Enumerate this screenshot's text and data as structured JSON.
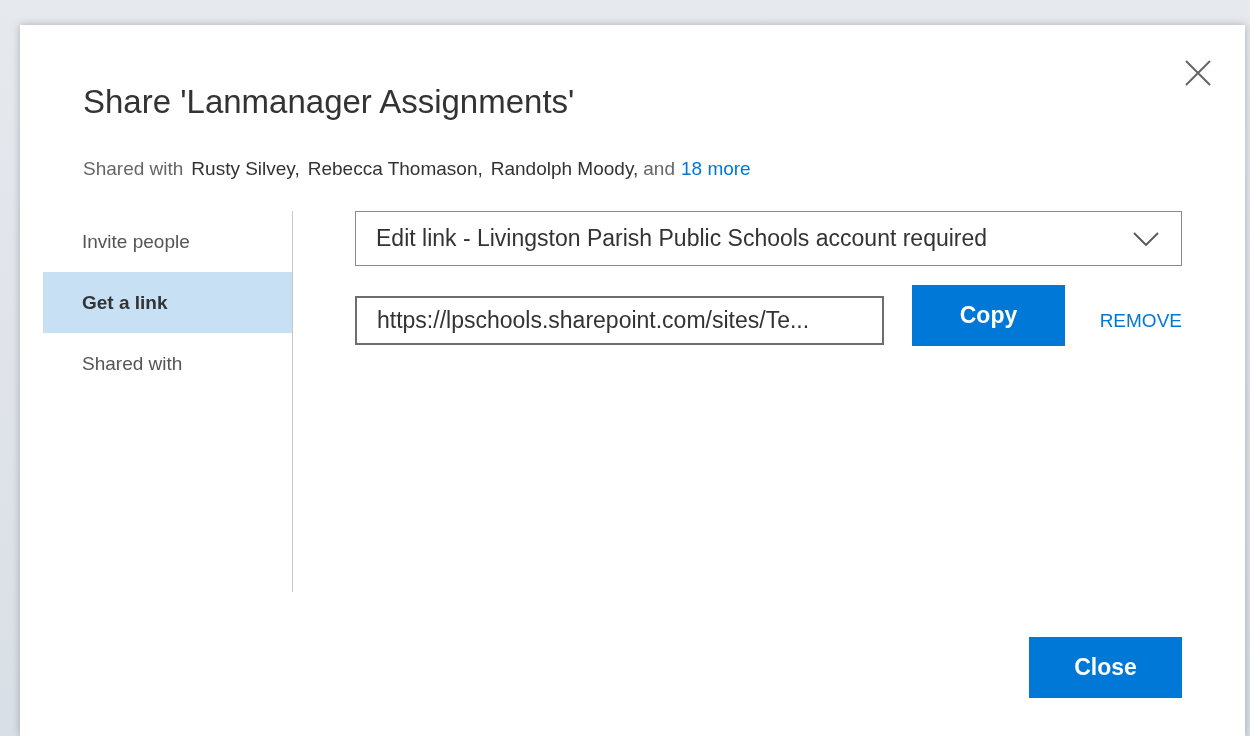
{
  "dialog": {
    "title": "Share 'Lanmanager Assignments'",
    "shared_with": {
      "label": "Shared with",
      "names": [
        "Rusty Silvey,",
        "Rebecca Thomason,",
        "Randolph Moody,"
      ],
      "conjunction": "and",
      "more_link": "18 more"
    },
    "nav": [
      {
        "label": "Invite people",
        "selected": false
      },
      {
        "label": "Get a link",
        "selected": true
      },
      {
        "label": "Shared with",
        "selected": false
      }
    ],
    "link_type": {
      "value": "Edit link - Livingston Parish Public Schools account required"
    },
    "link_url": {
      "value": "https://lpschools.sharepoint.com/sites/Te..."
    },
    "copy_button": "Copy",
    "remove_link": "REMOVE",
    "close_button": "Close"
  }
}
